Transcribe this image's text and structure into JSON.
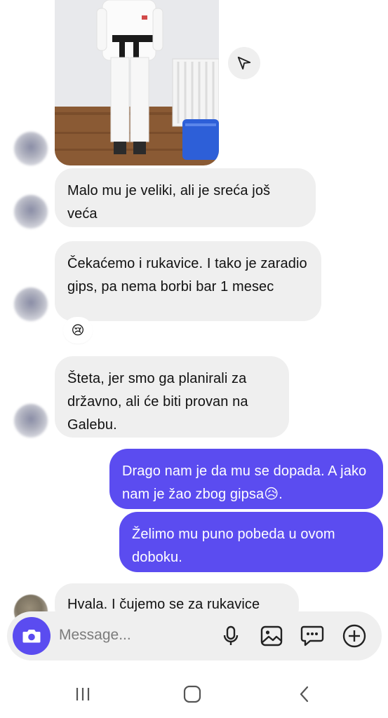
{
  "messages": [
    {
      "id": "m1",
      "direction": "received",
      "text": "Malo mu je veliki, ali je sreća još veća"
    },
    {
      "id": "m2",
      "direction": "received",
      "text": "Čekaćemo i rukavice. I tako je zaradio gips, pa nema borbi bar 1 mesec",
      "reaction": "😢"
    },
    {
      "id": "m3",
      "direction": "received",
      "text": "Šteta, jer smo ga planirali za državno, ali će biti provan na Galebu."
    },
    {
      "id": "m4",
      "direction": "sent",
      "text": "Drago nam je da mu se dopada. A jako nam je žao zbog gipsa😥."
    },
    {
      "id": "m5",
      "direction": "sent",
      "text": "Želimo mu puno pobeda u ovom doboku."
    },
    {
      "id": "m6",
      "direction": "received",
      "text": "Hvala. I čujemo se za rukavice"
    }
  ],
  "composer": {
    "placeholder": "Message...",
    "icons": [
      "camera-icon",
      "microphone-icon",
      "gallery-icon",
      "sticker-icon",
      "add-icon"
    ]
  },
  "navbar": {
    "icons": [
      "recents-icon",
      "home-icon",
      "back-icon"
    ]
  },
  "colors": {
    "sent_bubble": "#5b4cf0",
    "received_bubble": "#efefef",
    "accent": "#5b4cf0"
  }
}
